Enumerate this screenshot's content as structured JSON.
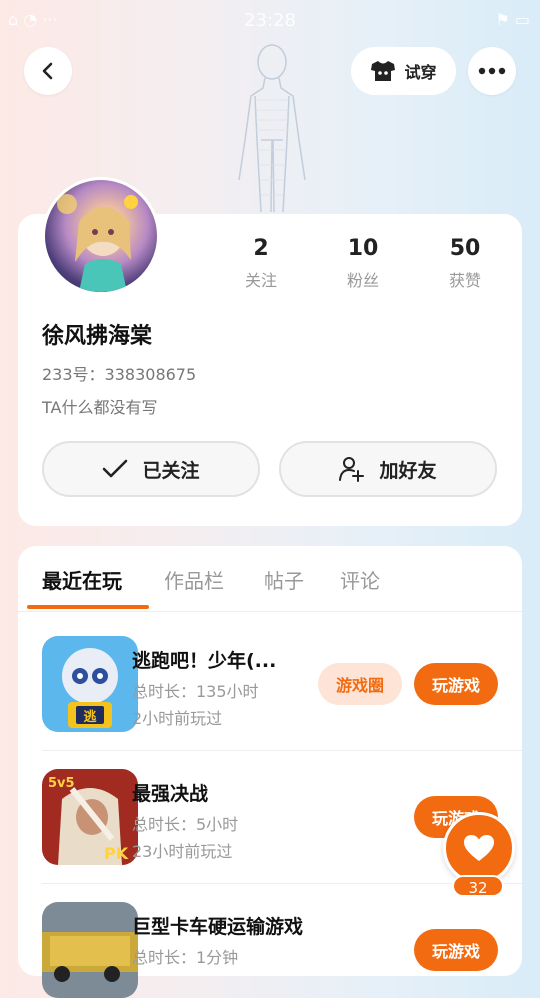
{
  "status_bar": {
    "time": "23:28"
  },
  "header": {
    "try_on_label": "试穿",
    "icons": {
      "back": "chevron-left-icon",
      "try_on": "tshirt-icon",
      "more": "more-dots-icon"
    }
  },
  "profile": {
    "stats": [
      {
        "num": "2",
        "label": "关注"
      },
      {
        "num": "10",
        "label": "粉丝"
      },
      {
        "num": "50",
        "label": "获赞"
      }
    ],
    "nickname": "徐风拂海棠",
    "uid": "233号：338308675",
    "bio": "TA什么都没有写",
    "followed_label": "已关注",
    "add_friend_label": "加好友"
  },
  "tabs": [
    {
      "label": "最近在玩",
      "active": true
    },
    {
      "label": "作品栏",
      "active": false
    },
    {
      "label": "帖子",
      "active": false
    },
    {
      "label": "评论",
      "active": false
    }
  ],
  "games": [
    {
      "title": "逃跑吧！少年(...",
      "duration": "总时长：135小时",
      "last_played": "2小时前玩过",
      "circle_label": "游戏圈",
      "play_label": "玩游戏"
    },
    {
      "title": "最强决战",
      "duration": "总时长：5小时",
      "last_played": "23小时前玩过",
      "play_label": "玩游戏"
    },
    {
      "title": "巨型卡车硬运输游戏",
      "duration": "总时长：1分钟",
      "play_label": "玩游戏"
    }
  ],
  "like": {
    "count": "32"
  },
  "colors": {
    "accent": "#f26b10",
    "accent_light": "#fde4d6"
  }
}
